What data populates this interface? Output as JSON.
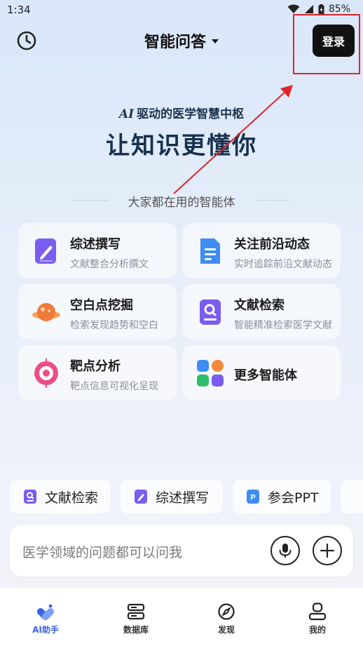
{
  "status": {
    "time": "1:34",
    "battery": "85%"
  },
  "header": {
    "title": "智能问答",
    "login_label": "登录"
  },
  "hero": {
    "tagline": "驱动的医学智慧中枢",
    "logo_text": "AI",
    "title": "让知识更懂你"
  },
  "agents": {
    "section_label": "大家都在用的智能体",
    "items": [
      {
        "title": "综述撰写",
        "subtitle": "文献整合分析撰文",
        "icon": "document-pen-icon"
      },
      {
        "title": "关注前沿动态",
        "subtitle": "实时追踪前沿文献动态",
        "icon": "document-list-icon"
      },
      {
        "title": "空白点挖掘",
        "subtitle": "检索发现趋势和空白",
        "icon": "planet-icon"
      },
      {
        "title": "文献检索",
        "subtitle": "智能精准检索医学文献",
        "icon": "search-document-icon"
      },
      {
        "title": "靶点分析",
        "subtitle": "靶点信息可视化呈现",
        "icon": "target-icon"
      },
      {
        "title": "更多智能体",
        "subtitle": "",
        "icon": "grid-apps-icon"
      }
    ]
  },
  "quick_chips": [
    {
      "label": "文献检索",
      "icon": "search-document-icon"
    },
    {
      "label": "综述撰写",
      "icon": "document-pen-icon"
    },
    {
      "label": "参会PPT",
      "icon": "ppt-icon"
    }
  ],
  "input": {
    "placeholder": "医学领域的问题都可以问我"
  },
  "tabs": [
    {
      "label": "AI助手",
      "icon": "ai-assistant-icon",
      "active": true
    },
    {
      "label": "数据库",
      "icon": "database-icon",
      "active": false
    },
    {
      "label": "发现",
      "icon": "compass-icon",
      "active": false
    },
    {
      "label": "我的",
      "icon": "profile-icon",
      "active": false
    }
  ],
  "colors": {
    "accent": "#3a62e8",
    "purple": "#7b5cf0",
    "annotation": "#e0262a"
  }
}
